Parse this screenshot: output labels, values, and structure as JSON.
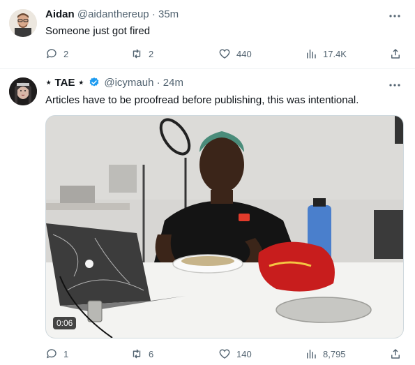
{
  "tweets": [
    {
      "author": {
        "name": "Aidan",
        "handle": "@aidanthereup",
        "time": "35m"
      },
      "text": "Someone just got fired",
      "stats": {
        "replies": "2",
        "retweets": "2",
        "likes": "440",
        "views": "17.4K"
      }
    },
    {
      "author": {
        "name": "⋆ TAE ⋆",
        "handle": "@icymauh",
        "time": "24m",
        "verified": true
      },
      "text": "Articles have to be proofread before publishing, this was intentional.",
      "media": {
        "type": "video",
        "duration": "0:06"
      },
      "stats": {
        "replies": "1",
        "retweets": "6",
        "likes": "140",
        "views": "8,795"
      }
    }
  ],
  "separator": "·",
  "icons": [
    "more-icon",
    "reply-icon",
    "retweet-icon",
    "like-icon",
    "views-icon",
    "share-icon",
    "verified-badge-icon"
  ],
  "colors": {
    "text": "#0f1419",
    "secondary": "#536471",
    "verified": "#1d9bf0",
    "border": "#eff3f4"
  }
}
